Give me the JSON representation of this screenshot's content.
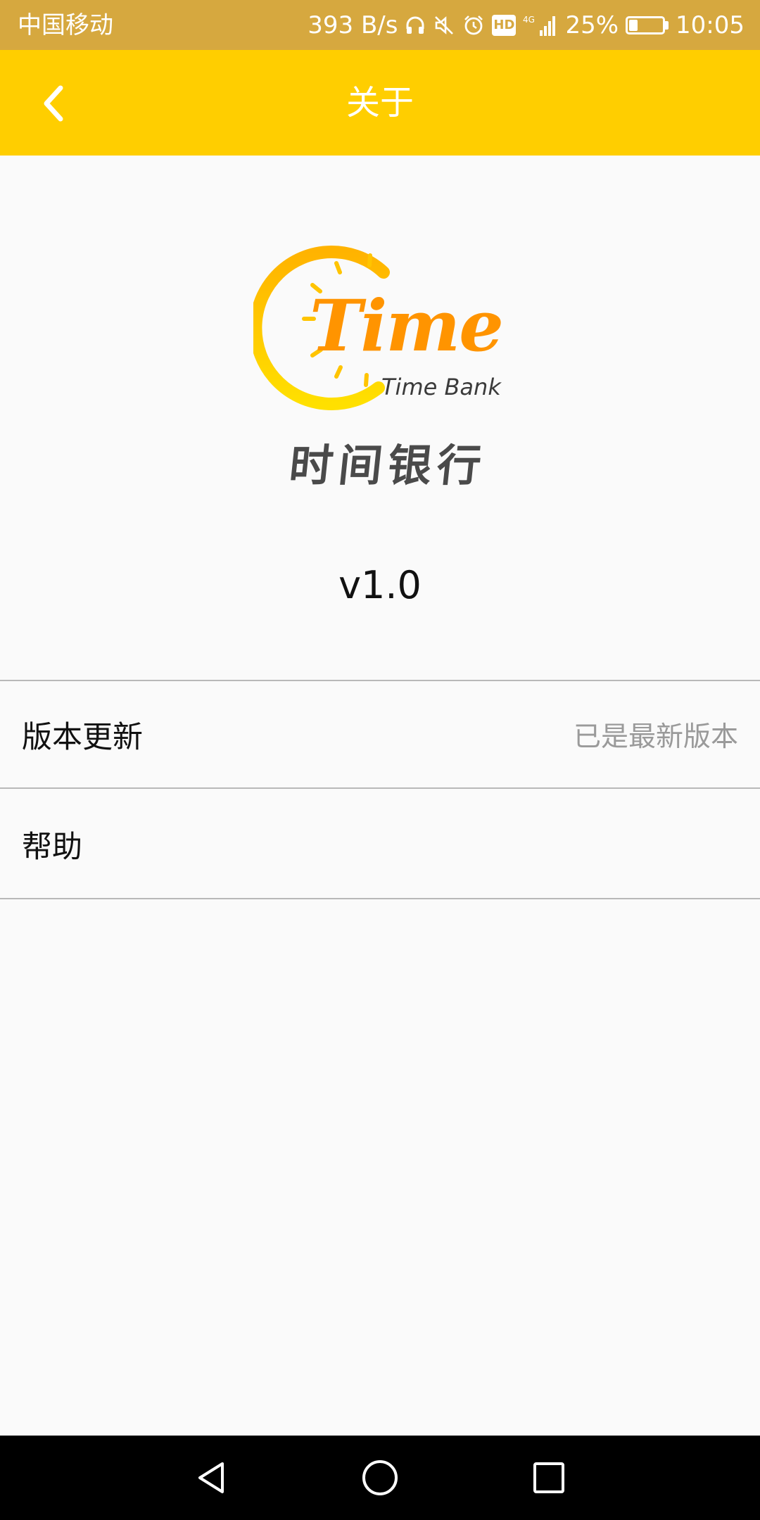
{
  "status_bar": {
    "carrier": "中国移动",
    "network_speed": "393 B/s",
    "icons": [
      "headphones-icon",
      "mute-icon",
      "alarm-icon",
      "hd-icon",
      "4g-signal-icon",
      "battery-icon"
    ],
    "hd_label": "HD",
    "battery_percent": "25%",
    "battery_level": 0.25,
    "time": "10:05"
  },
  "header": {
    "title": "关于",
    "back_icon": "chevron-left-icon",
    "background_color": "#ffce00"
  },
  "logo": {
    "wordmark": "Time",
    "subline": "Time Bank",
    "name_cn": "时间银行"
  },
  "version": "v1.0",
  "settings": {
    "items": [
      {
        "label": "版本更新",
        "value": "已是最新版本"
      },
      {
        "label": "帮助"
      }
    ]
  },
  "nav_bar": {
    "buttons": [
      "back-triangle-icon",
      "home-circle-icon",
      "recents-square-icon"
    ]
  }
}
